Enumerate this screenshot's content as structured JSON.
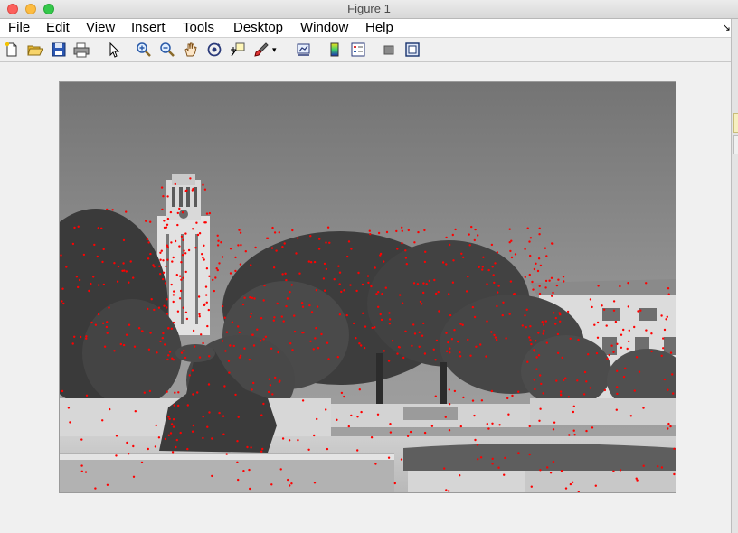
{
  "window": {
    "title": "Figure 1"
  },
  "menu": {
    "items": [
      "File",
      "Edit",
      "View",
      "Insert",
      "Tools",
      "Desktop",
      "Window",
      "Help"
    ],
    "overflow_glyph": "↘"
  },
  "toolbar": {
    "tools": [
      "new-figure-icon",
      "open-file-icon",
      "save-icon",
      "print-icon",
      "edit-plot-pointer-icon",
      "zoom-in-icon",
      "zoom-out-icon",
      "pan-hand-icon",
      "rotate-3d-icon",
      "data-cursor-icon",
      "brush-icon",
      "brush-dropdown-icon",
      "link-plot-icon",
      "insert-colorbar-icon",
      "insert-legend-icon",
      "hide-plot-tools-icon",
      "show-plot-tools-icon"
    ]
  },
  "figure": {
    "image_description_icon": "grayscale-photo-with-red-feature-points",
    "marker_color": "#ff0000"
  }
}
